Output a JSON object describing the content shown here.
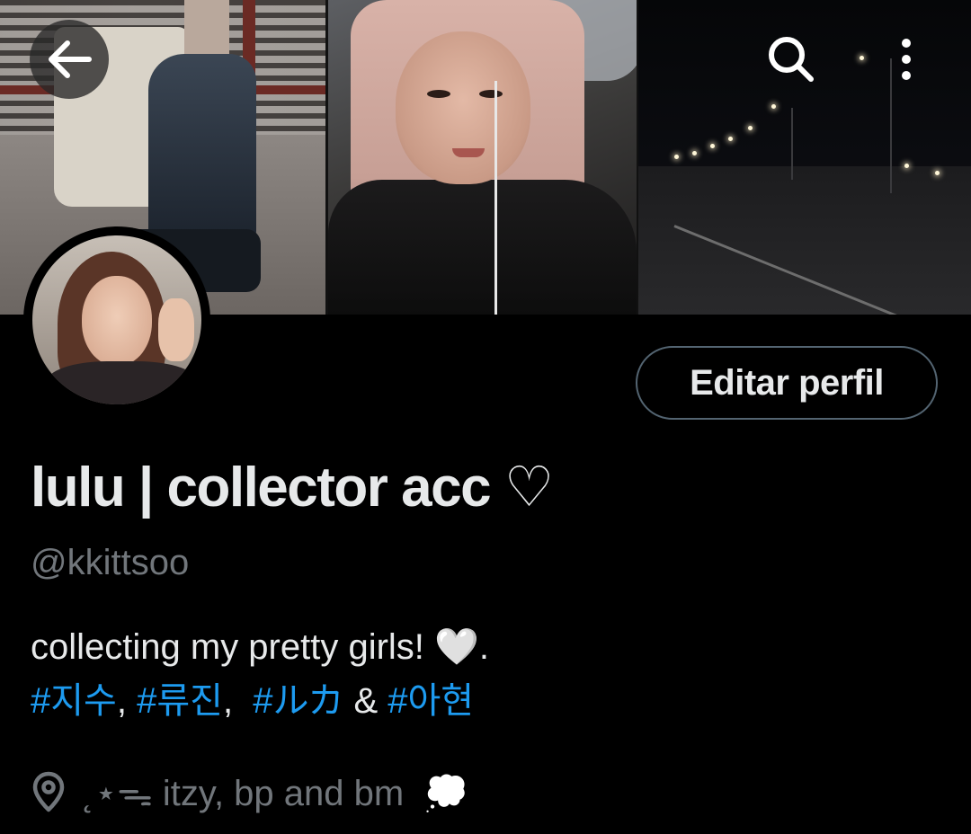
{
  "header": {
    "back_icon": "arrow-left-icon",
    "search_icon": "search-icon",
    "more_icon": "more-vertical-icon"
  },
  "profile": {
    "edit_button_label": "Editar perfil",
    "display_name": "lulu | collector acc ♡",
    "handle": "@kkittsoo",
    "bio_line1": "collecting my pretty girls! 🤍.",
    "bio_line2": [
      {
        "text": "#지수",
        "type": "hashtag"
      },
      {
        "text": ", ",
        "type": "text"
      },
      {
        "text": "#류진",
        "type": "hashtag"
      },
      {
        "text": ",  ",
        "type": "text"
      },
      {
        "text": "#ルカ",
        "type": "hashtag"
      },
      {
        "text": " & ",
        "type": "text"
      },
      {
        "text": "#아현",
        "type": "hashtag"
      }
    ],
    "location_icon": "location-pin-icon",
    "location": "˛⋆ᯓ itzy, bp and bm  💭"
  },
  "colors": {
    "background": "#000000",
    "primary_text": "#e7e9ea",
    "secondary_text": "#71767b",
    "link": "#1d9bf0",
    "button_border": "#536471"
  }
}
